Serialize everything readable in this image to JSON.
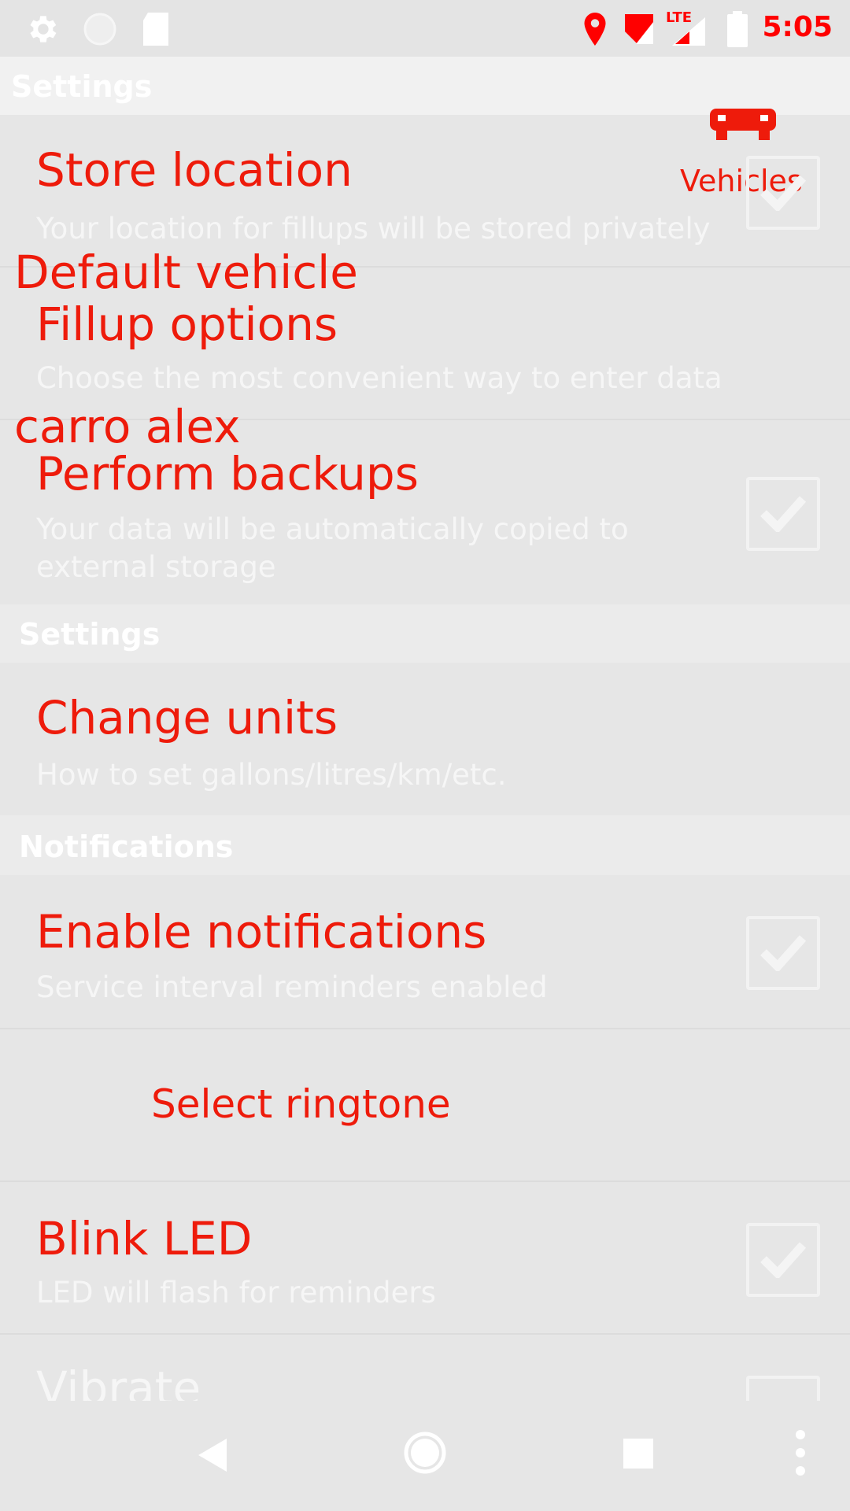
{
  "status_bar": {
    "time": "5:05",
    "network_label": "LTE",
    "icons": [
      "settings-gear-icon",
      "circle-icon",
      "sd-card-icon",
      "location-pin-icon",
      "volte-signal-icon",
      "lte-signal-icon",
      "battery-icon"
    ]
  },
  "app_bar": {
    "title": "Settings",
    "vehicles_label": "Vehicles",
    "vehicles_icon": "car-icon"
  },
  "overlay": {
    "default_vehicle_label": "Default vehicle",
    "default_vehicle_value": "carro alex"
  },
  "preferences": {
    "store_location": {
      "title": "Store location",
      "summary": "Your location for fillups will be stored privately",
      "checked": true
    },
    "fillup_options": {
      "title": "Fillup options",
      "summary": "Choose the most convenient way to enter data"
    },
    "perform_backups": {
      "title": "Perform backups",
      "summary_line1": "Your data will be automatically copied to",
      "summary_line2": "external storage",
      "checked": true
    }
  },
  "sections": {
    "settings_header": "Settings",
    "notifications_header": "Notifications"
  },
  "units": {
    "title": "Change units",
    "summary": "How to set gallons/litres/km/etc."
  },
  "notifications": {
    "enable": {
      "title": "Enable notifications",
      "summary": "Service interval reminders enabled",
      "checked": true
    },
    "ringtone": {
      "title": "Select ringtone"
    },
    "blink_led": {
      "title": "Blink LED",
      "summary": "LED will flash for reminders",
      "checked": true
    },
    "vibrate": {
      "title": "Vibrate"
    }
  },
  "nav_bar": {
    "icons": [
      "back-icon",
      "home-icon",
      "recents-icon",
      "overflow-menu-icon"
    ]
  },
  "colors": {
    "accent": "#ee1b0b",
    "background": "#e6e6e6",
    "faded_text": "#f6f6f6"
  }
}
